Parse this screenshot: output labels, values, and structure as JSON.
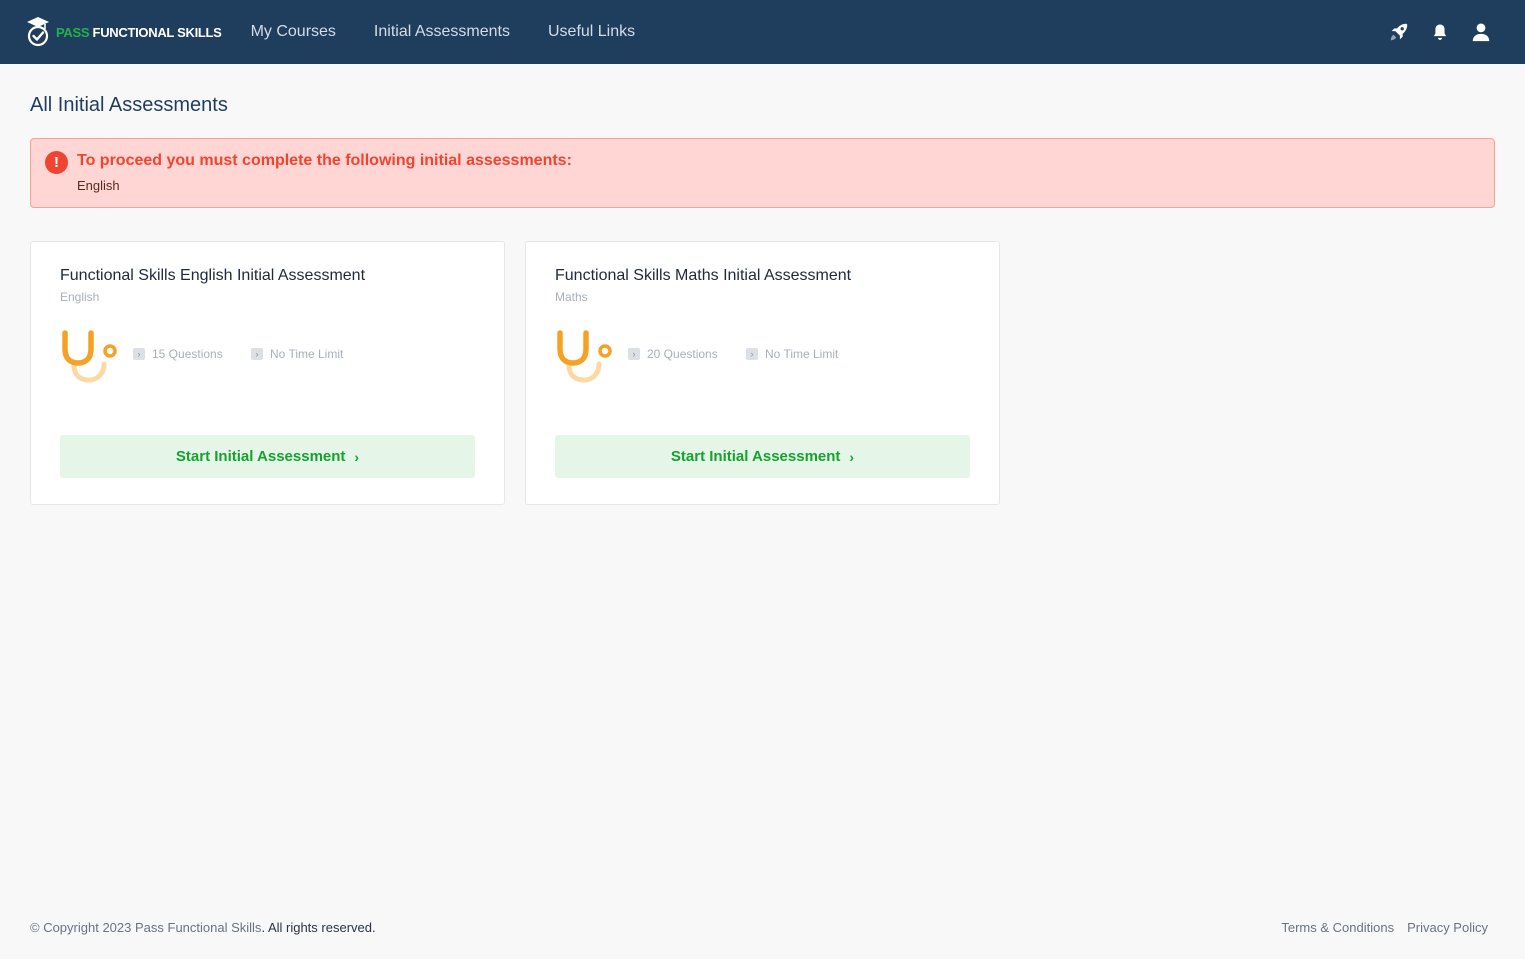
{
  "header": {
    "logo_pass": "PASS",
    "logo_rest": " FUNCTIONAL SKILLS",
    "nav": [
      {
        "label": "My Courses"
      },
      {
        "label": "Initial Assessments"
      },
      {
        "label": "Useful Links"
      }
    ],
    "icons": [
      "rocket-icon",
      "bell-icon",
      "user-icon"
    ]
  },
  "page": {
    "title": "All Initial Assessments"
  },
  "alert": {
    "icon": "!",
    "title": "To proceed you must complete the following initial assessments:",
    "body": "English"
  },
  "cards": [
    {
      "title": "Functional Skills English Initial Assessment",
      "subject": "English",
      "questions": "15 Questions",
      "time": "No Time Limit",
      "button": "Start Initial Assessment"
    },
    {
      "title": "Functional Skills Maths Initial Assessment",
      "subject": "Maths",
      "questions": "20 Questions",
      "time": "No Time Limit",
      "button": "Start Initial Assessment"
    }
  ],
  "footer": {
    "copyright": "© Copyright 2023 ",
    "brand": "Pass Functional Skills",
    "rights": ". All rights reserved.",
    "links": [
      {
        "label": "Terms & Conditions"
      },
      {
        "label": "Privacy Policy"
      }
    ]
  },
  "colors": {
    "header_bg": "#1f3d5c",
    "accent_green": "#16a22f",
    "alert_red": "#f04432",
    "graphic_orange": "#f5a224"
  }
}
